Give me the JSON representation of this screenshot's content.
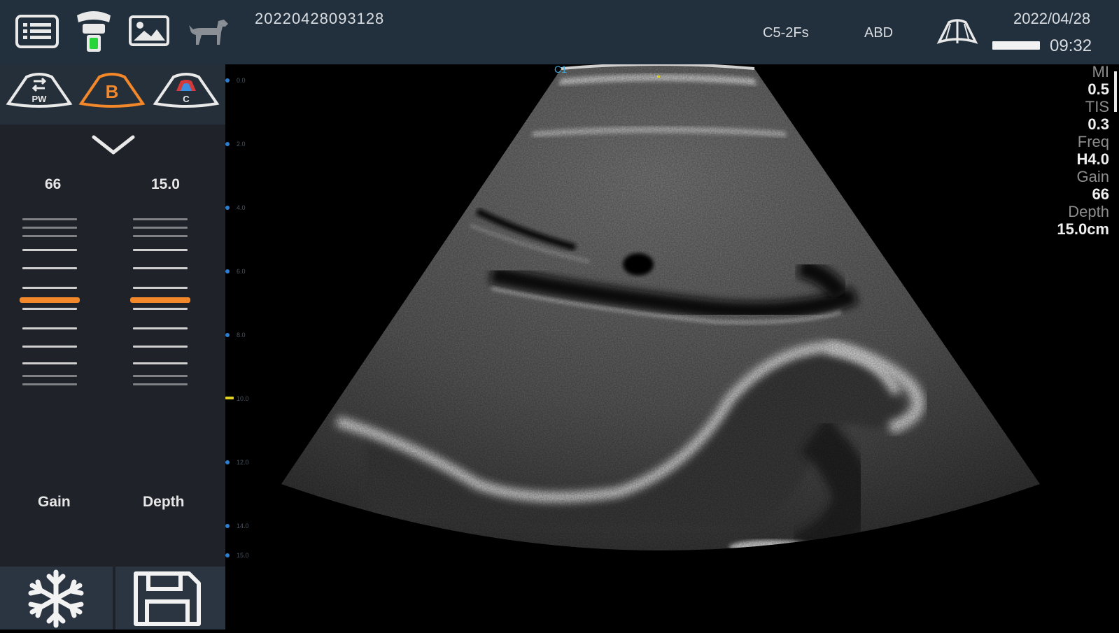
{
  "header": {
    "exam_id": "20220428093128",
    "probe": "C5-2Fs",
    "preset": "ABD",
    "date": "2022/04/28",
    "time": "09:32",
    "icons": [
      "list-icon",
      "probe-icon",
      "image-gallery-icon",
      "dog-icon",
      "biopsy-guide-icon",
      "battery-icon"
    ]
  },
  "modes": {
    "pw_label": "PW",
    "b_label": "B",
    "c_label": "C",
    "active": "B"
  },
  "controls": {
    "gain": {
      "label": "Gain",
      "value": "66",
      "level": 0.45
    },
    "depth": {
      "label": "Depth",
      "value": "15.0",
      "level": 0.45
    }
  },
  "image_params": {
    "mi_label": "MI",
    "mi_value": "0.5",
    "tis_label": "TIS",
    "tis_value": "0.3",
    "freq_label": "Freq",
    "freq_value": "H4.0",
    "gain_label": "Gain",
    "gain_value": "66",
    "depth_label": "Depth",
    "depth_value": "15.0cm"
  },
  "depth_scale": [
    "0.0",
    "2.0",
    "4.0",
    "6.0",
    "8.0",
    "10.0",
    "12.0",
    "14.0",
    "15.0"
  ],
  "colors": {
    "topbar": "#22303d",
    "panel": "#1f2329",
    "accent": "#f2882a",
    "scale_dot": "#2c7fd0"
  }
}
